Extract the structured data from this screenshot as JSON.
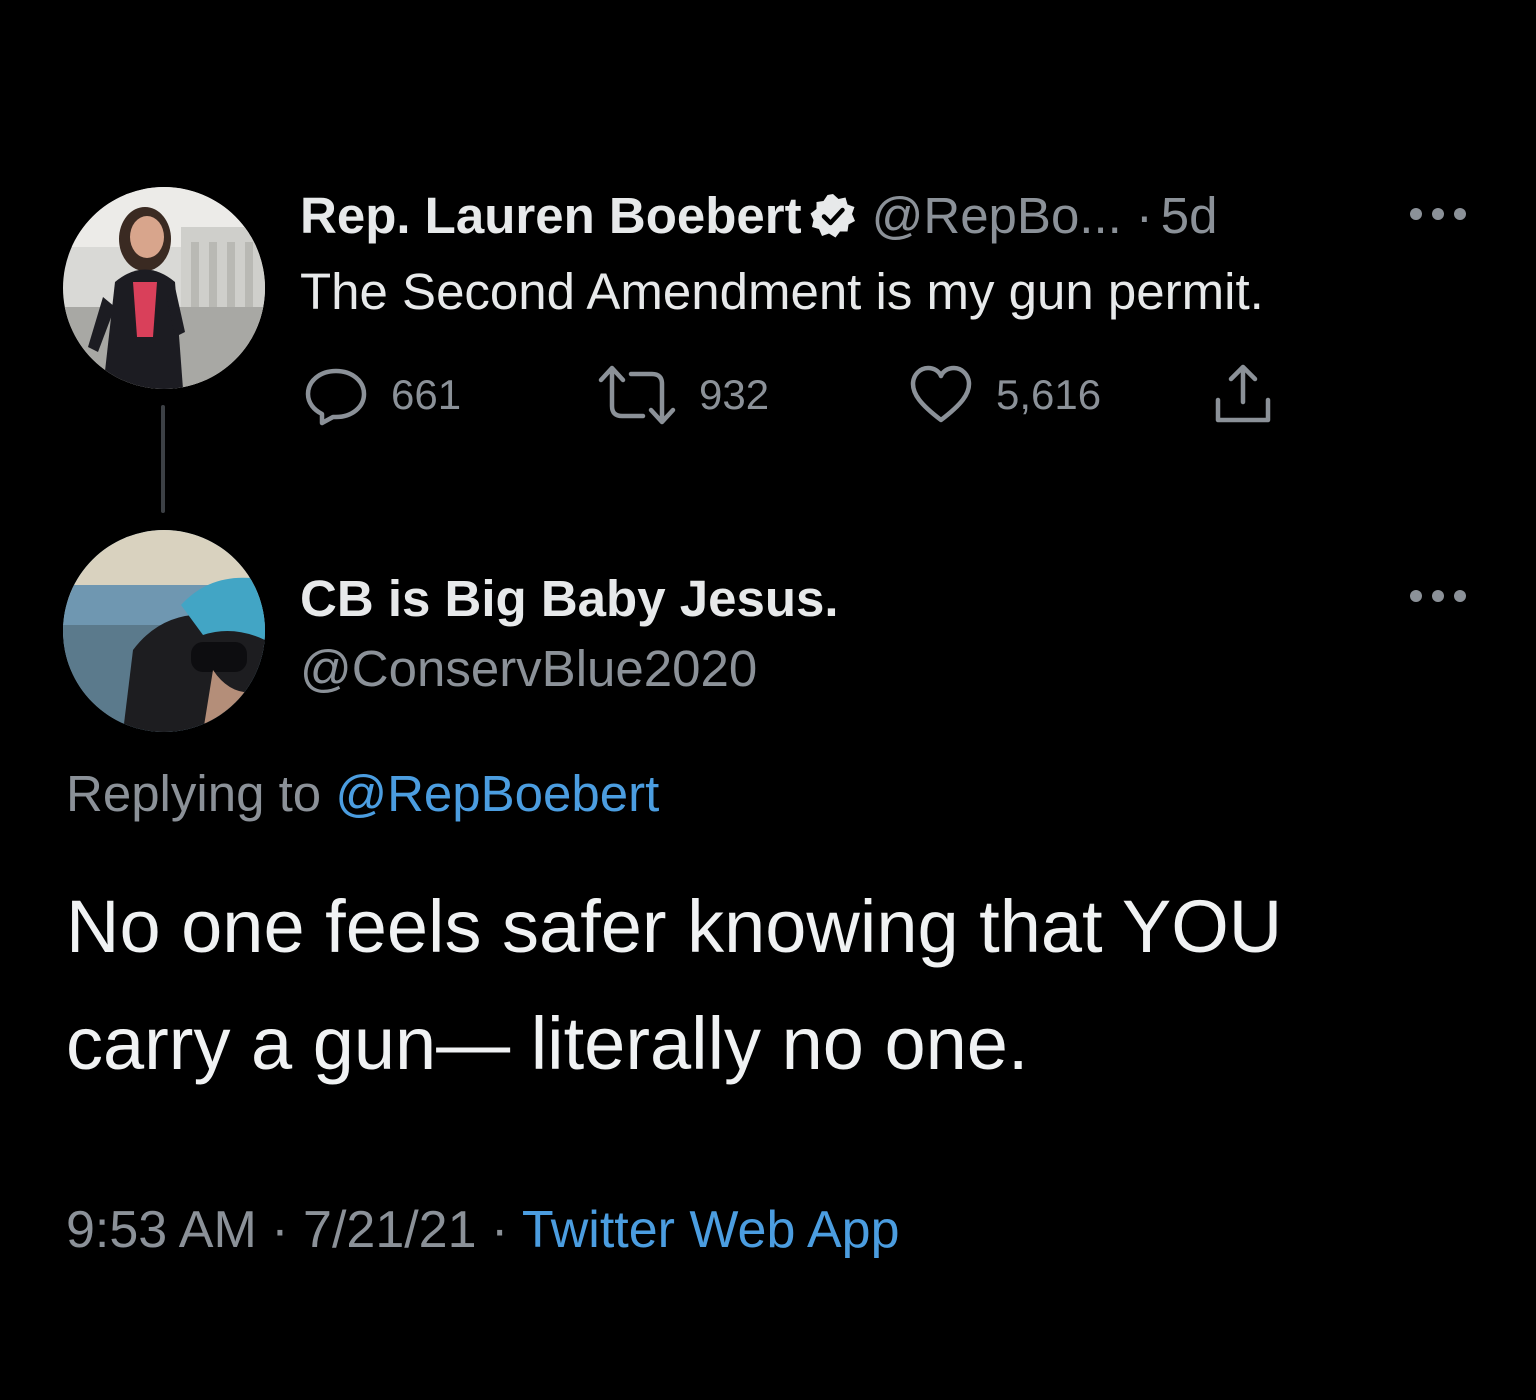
{
  "parent_tweet": {
    "display_name": "Rep. Lauren Boebert",
    "verified": true,
    "handle": "@RepBo...",
    "separator": "·",
    "age": "5d",
    "text": "The Second Amendment is my gun permit.",
    "actions": {
      "replies": "661",
      "retweets": "932",
      "likes": "5,616"
    }
  },
  "reply_tweet": {
    "display_name": "CB is Big Baby Jesus.",
    "handle": "@ConservBlue2020",
    "replying_to_label": "Replying to",
    "replying_to_handle": "@RepBoebert",
    "text_line_1": "No one feels safer knowing that YOU",
    "text_line_2": "carry a gun— literally no one.",
    "time": "9:53 AM",
    "date": "7/21/21",
    "separator": "·",
    "source": "Twitter Web App"
  },
  "colors": {
    "background": "#000000",
    "primary_text": "#e7e9ea",
    "secondary_text": "#8b9198",
    "link": "#4b9de0",
    "thread_line": "#3c4045"
  },
  "icons": [
    "verified-badge-icon",
    "more-icon",
    "reply-icon",
    "retweet-icon",
    "like-icon",
    "share-icon"
  ]
}
